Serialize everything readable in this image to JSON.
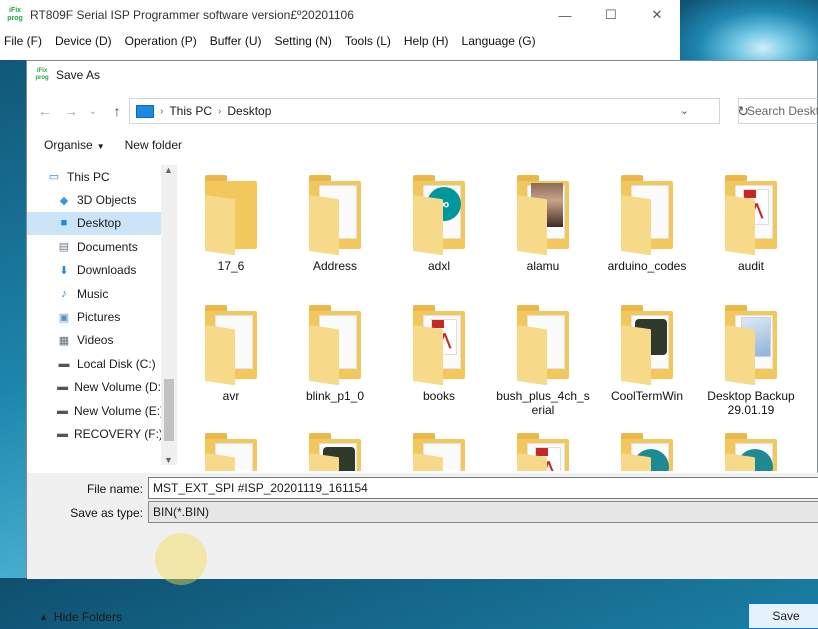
{
  "app": {
    "title": "RT809F Serial ISP Programmer software version£º20201106",
    "logo_text": [
      "iFix",
      "prog"
    ],
    "menu": [
      "File (F)",
      "Device (D)",
      "Operation (P)",
      "Buffer (U)",
      "Setting (N)",
      "Tools (L)",
      "Help (H)",
      "Language (G)"
    ],
    "controls": {
      "minimize": "—",
      "maximize": "☐",
      "close": "✕"
    }
  },
  "dialog": {
    "title": "Save As",
    "nav": {
      "back": "←",
      "forward": "→",
      "recent": "⌄",
      "up": "↑"
    },
    "address": {
      "crumbs": [
        "This PC",
        "Desktop"
      ],
      "separator": "›",
      "dropdown": "⌄",
      "refresh": "↻"
    },
    "search_placeholder": "Search Desktop",
    "toolbar": {
      "organise": "Organise",
      "new_folder": "New folder"
    },
    "sidebar": [
      {
        "label": "This PC",
        "icon": "computer-icon"
      },
      {
        "label": "3D Objects",
        "icon": "cube-icon"
      },
      {
        "label": "Desktop",
        "icon": "desktop-icon",
        "selected": true
      },
      {
        "label": "Documents",
        "icon": "document-icon"
      },
      {
        "label": "Downloads",
        "icon": "download-icon"
      },
      {
        "label": "Music",
        "icon": "music-icon"
      },
      {
        "label": "Pictures",
        "icon": "pictures-icon"
      },
      {
        "label": "Videos",
        "icon": "video-icon"
      },
      {
        "label": "Local Disk (C:)",
        "icon": "drive-icon"
      },
      {
        "label": "New Volume (D:",
        "icon": "drive-icon"
      },
      {
        "label": "New Volume (E:)",
        "icon": "drive-icon"
      },
      {
        "label": "RECOVERY (F:)",
        "icon": "drive-icon"
      }
    ],
    "files": [
      {
        "label": "17_6",
        "thumb": "none"
      },
      {
        "label": "Address",
        "thumb": "paper"
      },
      {
        "label": "adxl",
        "thumb": "arduino"
      },
      {
        "label": "alamu",
        "thumb": "photo"
      },
      {
        "label": "arduino_codes",
        "thumb": "paper"
      },
      {
        "label": "audit",
        "thumb": "pdf"
      },
      {
        "label": "avr",
        "thumb": "paper"
      },
      {
        "label": "blink_p1_0",
        "thumb": "paper"
      },
      {
        "label": "books",
        "thumb": "pdf"
      },
      {
        "label": "bush_plus_4ch_s\nerial",
        "thumb": "paper"
      },
      {
        "label": "CoolTermWin",
        "thumb": "dark"
      },
      {
        "label": "Desktop Backup\n29.01.19",
        "thumb": "blue"
      },
      {
        "label": "",
        "thumb": "paper"
      },
      {
        "label": "",
        "thumb": "dark"
      },
      {
        "label": "",
        "thumb": "paper"
      },
      {
        "label": "",
        "thumb": "pdf"
      },
      {
        "label": "",
        "thumb": "teal"
      },
      {
        "label": "",
        "thumb": "teal"
      }
    ],
    "file_name_label": "File name:",
    "file_name_value": "MST_EXT_SPI #ISP_20201119_161154",
    "save_type_label": "Save as type:",
    "save_type_value": "BIN(*.BIN)",
    "hide_folders": "Hide Folders",
    "save_button": "Save"
  }
}
